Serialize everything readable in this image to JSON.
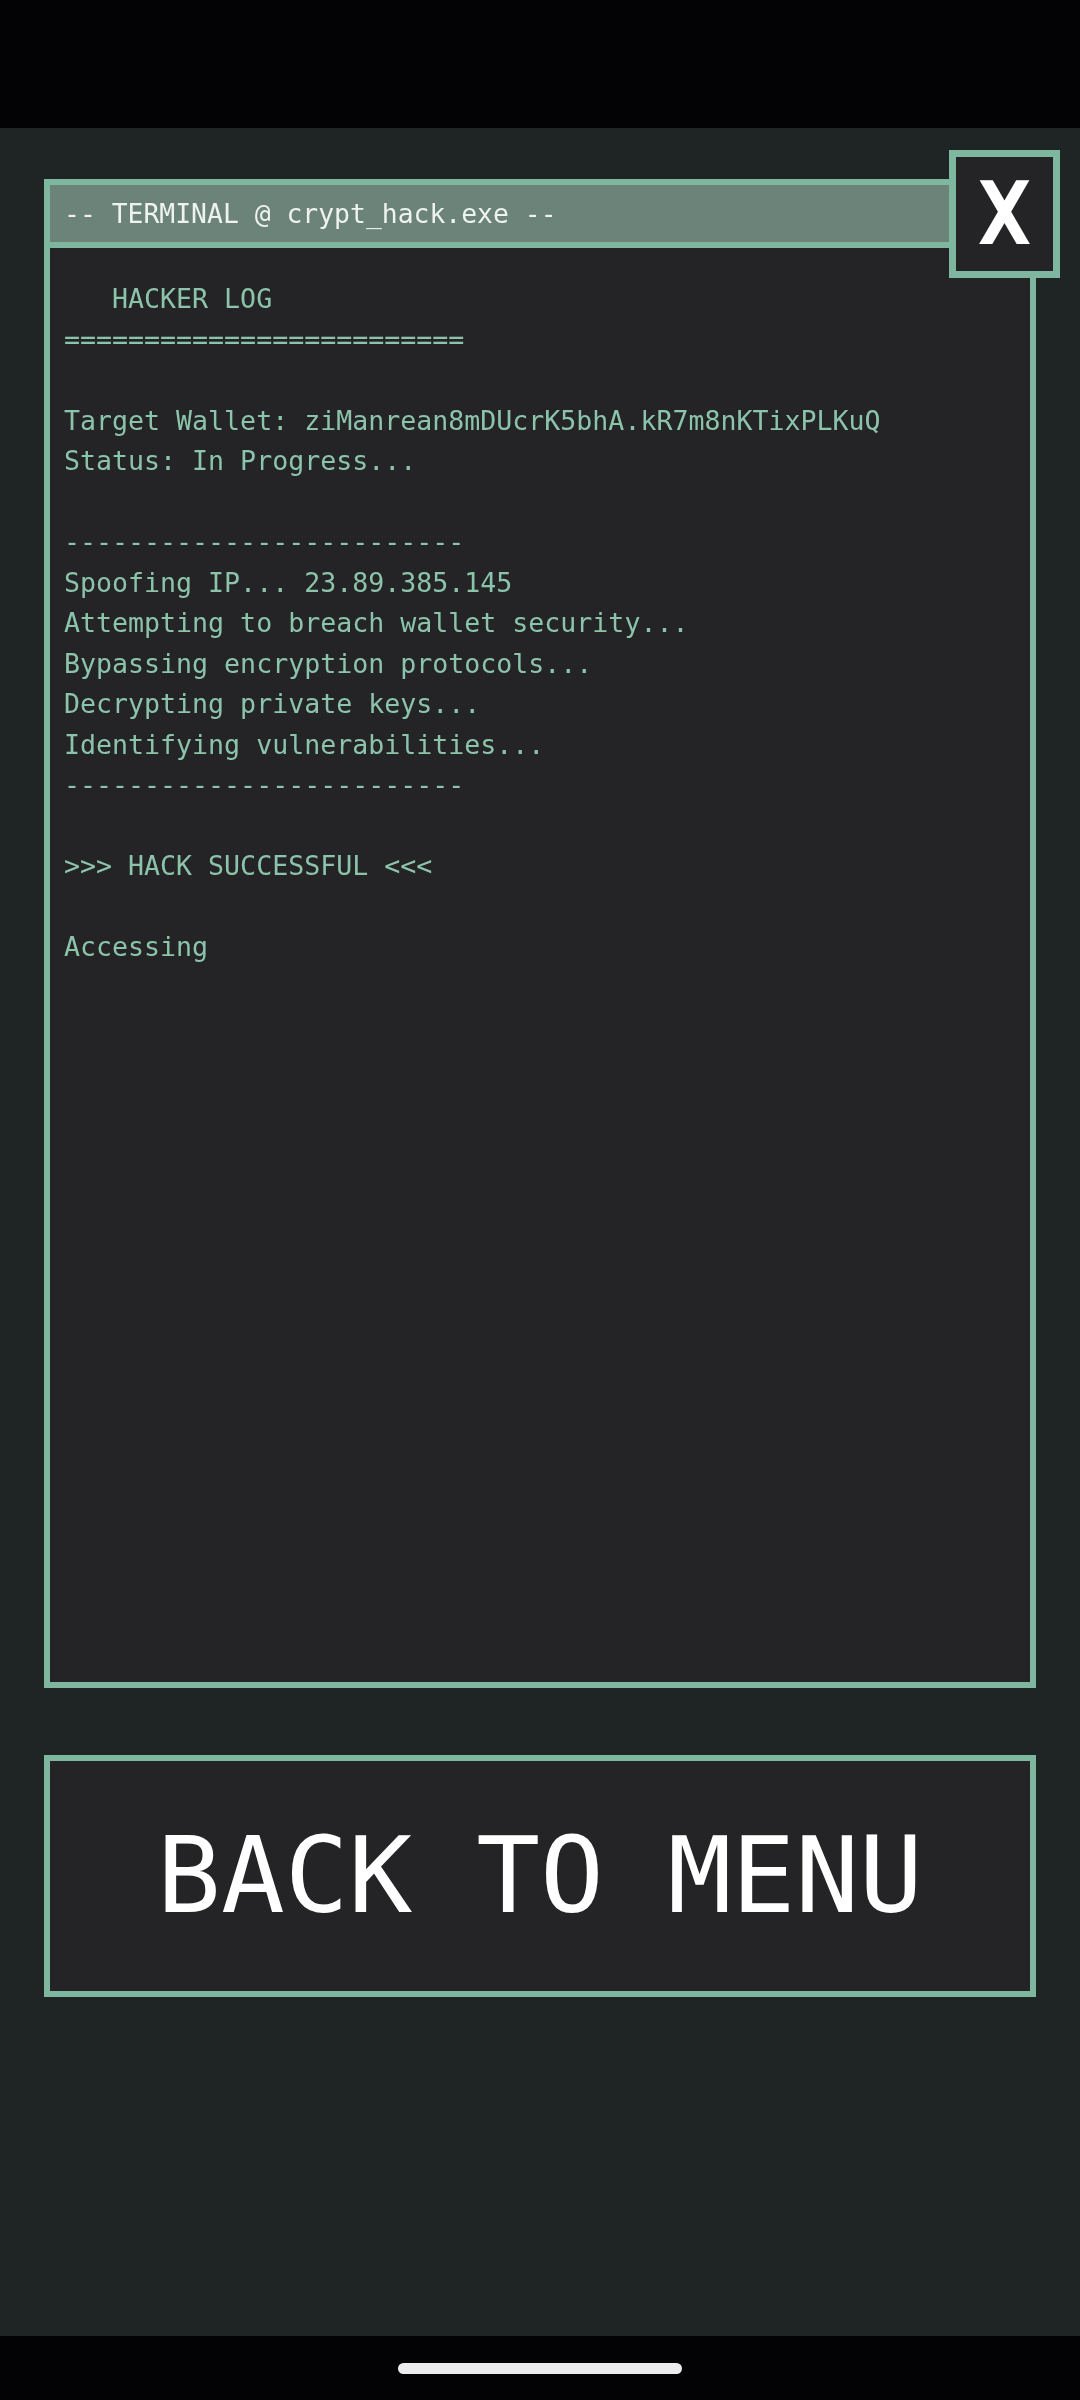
{
  "window": {
    "title": "-- TERMINAL @ crypt_hack.exe --",
    "close_label": "X"
  },
  "log": {
    "heading": "HACKER LOG",
    "heading_rule": "=========================",
    "blocks": [
      [
        "Target Wallet: ziManrean8mDUcrK5bhA.kR7m8nKTixPLKuQ",
        "Status: In Progress..."
      ],
      [
        "-------------------------",
        "Spoofing IP... 23.89.385.145",
        "Attempting to breach wallet security...",
        "Bypassing encryption protocols...",
        "Decrypting private keys...",
        "Identifying vulnerabilities...",
        "-------------------------"
      ],
      [
        ">>> HACK SUCCESSFUL <<<"
      ],
      [
        "Accessing"
      ]
    ]
  },
  "back_button": {
    "label": "BACK TO MENU"
  }
}
